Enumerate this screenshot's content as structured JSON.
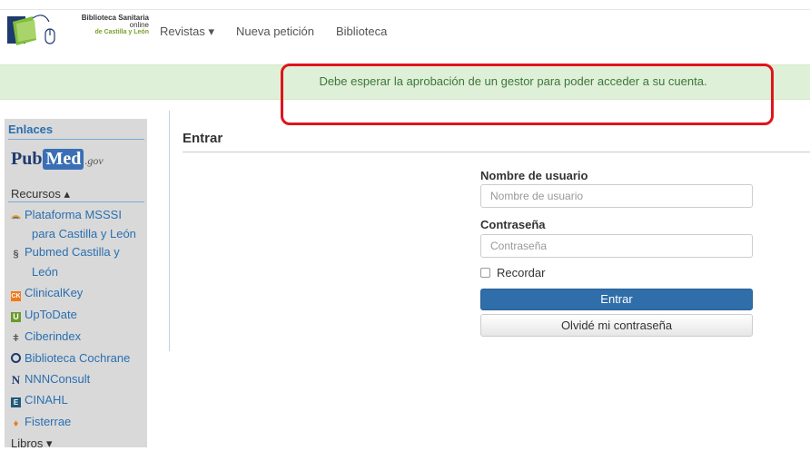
{
  "brand": {
    "line1": "Biblioteca Sanitaria",
    "line2": "online",
    "line3": "de Castilla y León"
  },
  "nav": {
    "revistas": "Revistas ▾",
    "nueva_peticion": "Nueva petición",
    "biblioteca": "Biblioteca"
  },
  "alert": {
    "message": "Debe esperar la aprobación de un gestor para poder acceder a su cuenta."
  },
  "sidebar": {
    "enlaces": "Enlaces",
    "pubmed_pub": "Pub",
    "pubmed_med": "Med",
    "pubmed_gov": ".gov",
    "recursos": "Recursos ▴",
    "items": [
      {
        "label": "Plataforma MSSSI",
        "icon": "rainbow-arc-icon"
      },
      {
        "label": "para Castilla y León",
        "icon": ""
      },
      {
        "label": "Pubmed Castilla y",
        "icon": "dna-icon"
      },
      {
        "label": "León",
        "icon": ""
      },
      {
        "label": "ClinicalKey",
        "icon": "ck-icon"
      },
      {
        "label": "UpToDate",
        "icon": "u-icon"
      },
      {
        "label": "Ciberindex",
        "icon": "ciberindex-icon"
      },
      {
        "label": "Biblioteca Cochrane",
        "icon": "cochrane-icon"
      },
      {
        "label": "NNNConsult",
        "icon": "n-icon"
      },
      {
        "label": "CINAHL",
        "icon": "cinahl-icon"
      },
      {
        "label": "Fisterrae",
        "icon": "fisterrae-icon"
      }
    ],
    "libros": "Libros ▾"
  },
  "login": {
    "title": "Entrar",
    "username_label": "Nombre de usuario",
    "username_placeholder": "Nombre de usuario",
    "password_label": "Contraseña",
    "password_placeholder": "Contraseña",
    "remember_label": "Recordar",
    "submit_label": "Entrar",
    "forgot_label": "Olvidé mi contraseña"
  },
  "colors": {
    "alert_bg": "#dff0d8",
    "alert_text": "#3c763d",
    "highlight_border": "#e0141c",
    "primary_button": "#2f6ea8",
    "link": "#2a6fb0"
  }
}
